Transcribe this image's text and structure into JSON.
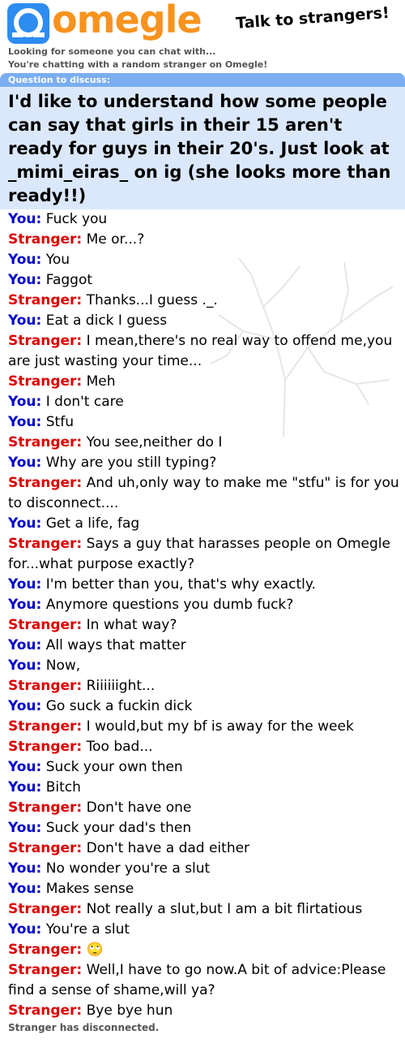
{
  "header": {
    "logo_text": "omegle",
    "tagline": "Talk to strangers!"
  },
  "status": {
    "looking": "Looking for someone you can chat with...",
    "chatting": "You're chatting with a random stranger on Omegle!"
  },
  "question": {
    "label": "Question to discuss:",
    "text": "I'd like to understand how some people can say that girls in their 15 aren't ready for guys in their 20's. Just look at _mimi_eiras_ on ig (she looks more than ready!!)"
  },
  "messages": [
    {
      "who": "you",
      "label": "You:",
      "text": "Fuck you"
    },
    {
      "who": "stranger",
      "label": "Stranger:",
      "text": "Me or...?"
    },
    {
      "who": "you",
      "label": "You:",
      "text": "You"
    },
    {
      "who": "you",
      "label": "You:",
      "text": "Faggot"
    },
    {
      "who": "stranger",
      "label": "Stranger:",
      "text": "Thanks...I guess ._."
    },
    {
      "who": "you",
      "label": "You:",
      "text": "Eat a dick I guess"
    },
    {
      "who": "stranger",
      "label": "Stranger:",
      "text": "I mean,there's no real way to offend me,you are just wasting your time..."
    },
    {
      "who": "stranger",
      "label": "Stranger:",
      "text": "Meh"
    },
    {
      "who": "you",
      "label": "You:",
      "text": "I don't care"
    },
    {
      "who": "you",
      "label": "You:",
      "text": "Stfu"
    },
    {
      "who": "stranger",
      "label": "Stranger:",
      "text": "You see,neither do I"
    },
    {
      "who": "you",
      "label": "You:",
      "text": "Why are you still typing?"
    },
    {
      "who": "stranger",
      "label": "Stranger:",
      "text": "And uh,only way to make me \"stfu\" is for you to disconnect...."
    },
    {
      "who": "you",
      "label": "You:",
      "text": "Get a life, fag"
    },
    {
      "who": "stranger",
      "label": "Stranger:",
      "text": "Says a guy that harasses people on Omegle for...what purpose exactly?"
    },
    {
      "who": "you",
      "label": "You:",
      "text": "I'm better than you, that's why exactly."
    },
    {
      "who": "you",
      "label": "You:",
      "text": "Anymore questions you dumb fuck?"
    },
    {
      "who": "stranger",
      "label": "Stranger:",
      "text": "In what way?"
    },
    {
      "who": "you",
      "label": "You:",
      "text": "All ways that matter"
    },
    {
      "who": "you",
      "label": "You:",
      "text": "Now,"
    },
    {
      "who": "stranger",
      "label": "Stranger:",
      "text": "Riiiiiight..."
    },
    {
      "who": "you",
      "label": "You:",
      "text": "Go suck a fuckin dick"
    },
    {
      "who": "stranger",
      "label": "Stranger:",
      "text": "I would,but my bf is away for the week"
    },
    {
      "who": "stranger",
      "label": "Stranger:",
      "text": "Too bad..."
    },
    {
      "who": "you",
      "label": "You:",
      "text": "Suck your own then"
    },
    {
      "who": "you",
      "label": "You:",
      "text": "Bitch"
    },
    {
      "who": "stranger",
      "label": "Stranger:",
      "text": "Don't have one"
    },
    {
      "who": "you",
      "label": "You:",
      "text": "Suck your dad's then"
    },
    {
      "who": "stranger",
      "label": "Stranger:",
      "text": "Don't have a dad either"
    },
    {
      "who": "you",
      "label": "You:",
      "text": "No wonder you're a slut"
    },
    {
      "who": "you",
      "label": "You:",
      "text": "Makes sense"
    },
    {
      "who": "stranger",
      "label": "Stranger:",
      "text": "Not really a slut,but I am a bit flirtatious"
    },
    {
      "who": "you",
      "label": "You:",
      "text": "You're a slut"
    },
    {
      "who": "stranger",
      "label": "Stranger:",
      "text": "🙄"
    },
    {
      "who": "stranger",
      "label": "Stranger:",
      "text": "Well,I have to go now.A bit of advice:Please find a sense of shame,will ya?"
    },
    {
      "who": "stranger",
      "label": "Stranger:",
      "text": "Bye bye hun"
    }
  ],
  "footer": {
    "disconnected": "Stranger has disconnected."
  },
  "colors": {
    "brand_orange": "#f7931e",
    "brand_blue": "#2d8cf0",
    "you": "#0000cc",
    "stranger": "#dd0000",
    "question_bg": "#dbe8fb",
    "question_label_bg": "#7aaef0"
  },
  "icons": {
    "logo": "omegle-logo-icon",
    "watermark": "tree-watermark-icon"
  }
}
